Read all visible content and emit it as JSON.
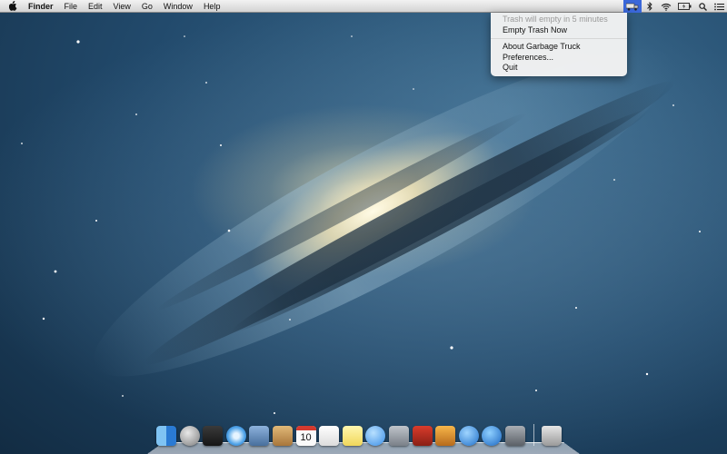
{
  "menubar": {
    "app_name": "Finder",
    "menus": [
      "File",
      "Edit",
      "View",
      "Go",
      "Window",
      "Help"
    ],
    "status_icons": [
      "garbage-truck-icon",
      "bluetooth-icon",
      "wifi-icon",
      "battery-icon",
      "search-icon",
      "notification-center-icon"
    ]
  },
  "dropdown": {
    "status": "Trash will empty in 5 minutes",
    "empty_now": "Empty Trash Now",
    "about": "About Garbage Truck",
    "preferences": "Preferences...",
    "quit": "Quit"
  },
  "dock": {
    "apps": [
      "Finder",
      "Launchpad",
      "Mission Control",
      "Safari",
      "Mail",
      "Contacts",
      "Calendar",
      "Reminders",
      "Notes",
      "Messages",
      "FaceTime",
      "Photo Booth",
      "iPhoto",
      "iTunes",
      "App Store",
      "System Preferences"
    ],
    "calendar_day": "10",
    "trash": "Trash"
  },
  "colors": {
    "menu_highlight": "#3a67d9",
    "desktop_deep": "#0e2438",
    "desktop_mid": "#224a6c"
  }
}
